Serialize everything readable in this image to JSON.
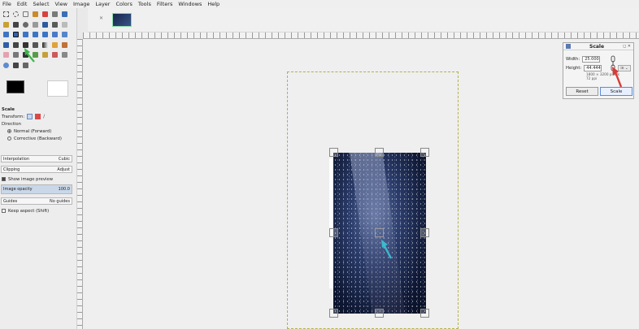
{
  "menu": [
    "File",
    "Edit",
    "Select",
    "View",
    "Image",
    "Layer",
    "Colors",
    "Tools",
    "Filters",
    "Windows",
    "Help"
  ],
  "tool_options": {
    "title": "Scale",
    "transform_label": "Transform:",
    "direction_label": "Direction",
    "direction_normal": "Normal (Forward)",
    "direction_corrective": "Corrective (Backward)",
    "interpolation_label": "Interpolation",
    "interpolation_value": "Cubic",
    "clipping_label": "Clipping",
    "clipping_value": "Adjust",
    "show_preview": "Show image preview",
    "opacity_label": "Image opacity",
    "opacity_value": "100.0",
    "guides_label": "Guides",
    "guides_value": "No guides",
    "keep_aspect": "Keep aspect (Shift)"
  },
  "dialog": {
    "title": "Scale",
    "width_label": "Width:",
    "width_value": "25.000",
    "height_label": "Height:",
    "height_value": "44.444",
    "size_info": "1800 × 3200 pixels",
    "res_info": "72 ppi",
    "unit": "in",
    "reset_label": "Reset",
    "scale_label": "Scale"
  },
  "colors": {
    "accent_teal": "#3bbbd0",
    "accent_red": "#d83a3a",
    "accent_green": "#3cb84a"
  }
}
